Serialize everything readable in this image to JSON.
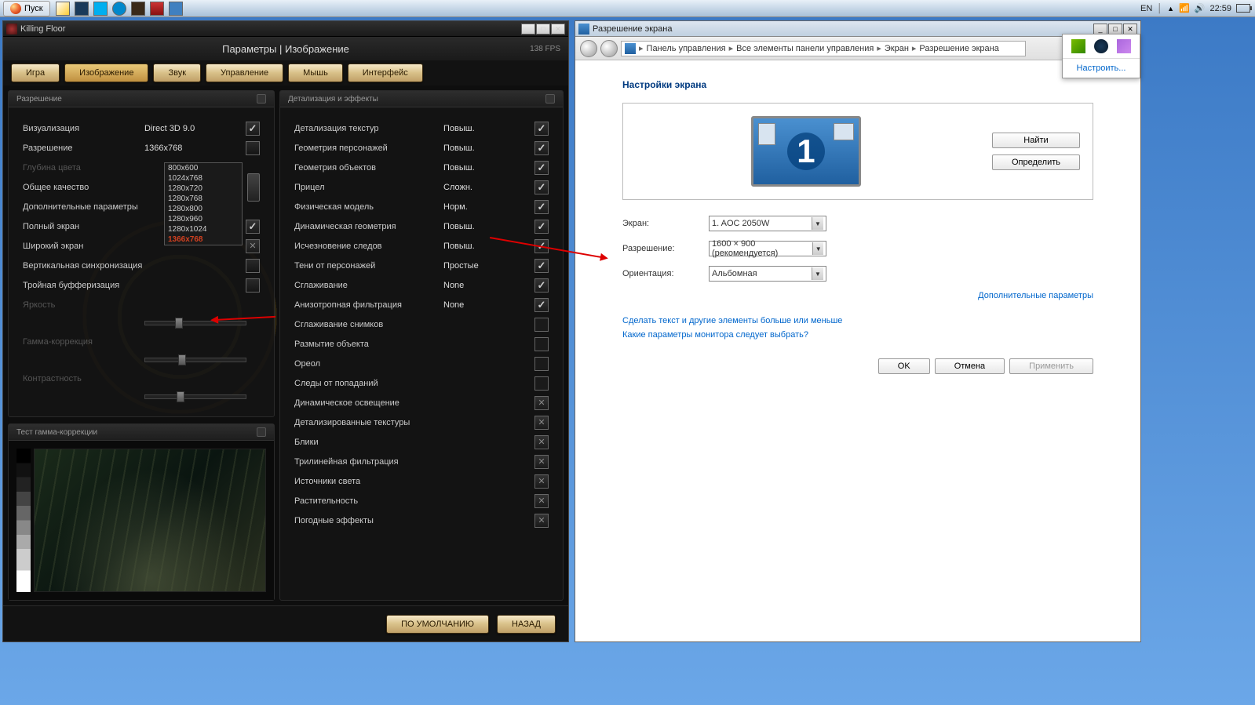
{
  "taskbar": {
    "start": "Пуск",
    "lang": "EN",
    "time": "22:59"
  },
  "tray_popup": {
    "configure": "Настроить..."
  },
  "game": {
    "title": "Killing Floor",
    "header": "Параметры | Изображение",
    "fps": "138 FPS",
    "tabs": {
      "game": "Игра",
      "image": "Изображение",
      "sound": "Звук",
      "control": "Управление",
      "mouse": "Мышь",
      "interface": "Интерфейс"
    },
    "panels": {
      "resolution": "Разрешение",
      "gamma": "Тест гамма-коррекции",
      "detail": "Детализация и эффекты"
    },
    "res": {
      "rendering": "Визуализация",
      "rendering_v": "Direct 3D 9.0",
      "resolution": "Разрешение",
      "resolution_v": "1366x768",
      "depth": "Глубина цвета",
      "quality": "Общее качество",
      "advanced": "Дополнительные параметры",
      "fullscreen": "Полный экран",
      "widescreen": "Широкий экран",
      "vsync": "Вертикальная синхронизация",
      "triple": "Тройная буфферизация",
      "bright": "Яркость",
      "gamma": "Гамма-коррекция",
      "contrast": "Контрастность",
      "options": [
        "800x600",
        "1024x768",
        "1280x720",
        "1280x768",
        "1280x800",
        "1280x960",
        "1280x1024",
        "1366x768"
      ]
    },
    "det": {
      "tex_detail": "Детализация текстур",
      "v1": "Повыш.",
      "char_geom": "Геометрия персонажей",
      "v2": "Повыш.",
      "obj_geom": "Геометрия объектов",
      "v3": "Повыш.",
      "crosshair": "Прицел",
      "v4": "Сложн.",
      "physics": "Физическая модель",
      "v5": "Норм.",
      "dyn_geom": "Динамическая геометрия",
      "v6": "Повыш.",
      "decals": "Исчезновение следов",
      "v7": "Повыш.",
      "shadows": "Тени от персонажей",
      "v8": "Простые",
      "aa": "Сглаживание",
      "v9": "None",
      "aniso": "Анизотропная фильтрация",
      "v10": "None",
      "screenshot_aa": "Сглаживание снимков",
      "blur": "Размытие объекта",
      "halo": "Ореол",
      "hitmarks": "Следы от попаданий",
      "dyn_light": "Динамическое освещение",
      "det_tex": "Детализированные текстуры",
      "glare": "Блики",
      "trilinear": "Трилинейная фильтрация",
      "light_src": "Источники света",
      "foliage": "Растительность",
      "weather": "Погодные эффекты"
    },
    "footer": {
      "default": "ПО УМОЛЧАНИЮ",
      "back": "НАЗАД"
    }
  },
  "cp": {
    "title": "Разрешение экрана",
    "crumbs": {
      "c1": "Панель управления",
      "c2": "Все элементы панели управления",
      "c3": "Экран",
      "c4": "Разрешение экрана"
    },
    "section": "Настройки экрана",
    "find": "Найти",
    "detect": "Определить",
    "monitor_num": "1",
    "lbl_screen": "Экран:",
    "val_screen": "1. AOC 2050W",
    "lbl_res": "Разрешение:",
    "val_res": "1600 × 900 (рекомендуется)",
    "lbl_orient": "Ориентация:",
    "val_orient": "Альбомная",
    "adv": "Дополнительные параметры",
    "link1": "Сделать текст и другие элементы больше или меньше",
    "link2": "Какие параметры монитора следует выбрать?",
    "ok": "OK",
    "cancel": "Отмена",
    "apply": "Применить"
  }
}
